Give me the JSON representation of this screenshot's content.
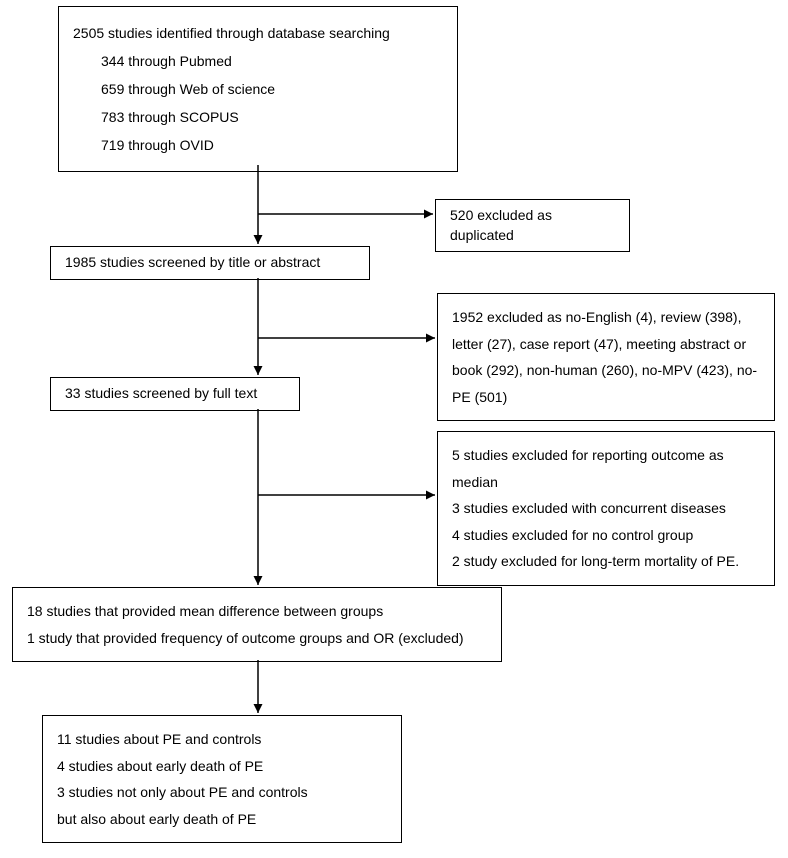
{
  "chart_data": {
    "type": "flow",
    "nodes": [
      {
        "id": "identified",
        "lines": [
          "2505 studies identified through database searching",
          "344 through Pubmed",
          "659 through Web of science",
          "783 through SCOPUS",
          "719 through OVID"
        ]
      },
      {
        "id": "dup",
        "lines": [
          "520 excluded as duplicated"
        ]
      },
      {
        "id": "screened_title",
        "lines": [
          "1985 studies screened by title or abstract"
        ]
      },
      {
        "id": "excl1952",
        "lines": [
          "1952 excluded as no-English (4), review (398), letter (27), case report (47), meeting abstract or book (292), non-human (260), no-MPV (423), no-PE (501)"
        ]
      },
      {
        "id": "screened_full",
        "lines": [
          "33 studies screened by full text"
        ]
      },
      {
        "id": "excl_full",
        "lines": [
          "5 studies excluded for reporting outcome as median",
          "3 studies excluded with concurrent diseases",
          "4 studies excluded for no control group",
          "2 study excluded for long-term mortality of PE."
        ]
      },
      {
        "id": "provided",
        "lines": [
          "18 studies that provided mean difference between groups",
          "1 study that provided frequency of outcome groups and OR (excluded)"
        ]
      },
      {
        "id": "final",
        "lines": [
          "11 studies about PE and controls",
          "4 studies about early death of PE",
          "3 studies not only about PE and controls",
          "but also about early death of PE"
        ]
      }
    ],
    "edges": [
      [
        "identified",
        "screened_title"
      ],
      [
        "identified",
        "dup"
      ],
      [
        "screened_title",
        "screened_full"
      ],
      [
        "screened_title",
        "excl1952"
      ],
      [
        "screened_full",
        "provided"
      ],
      [
        "screened_full",
        "excl_full"
      ],
      [
        "provided",
        "final"
      ]
    ]
  },
  "boxes": {
    "identified": {
      "header": "2505 studies identified through database searching",
      "items": [
        "344 through Pubmed",
        "659 through Web of science",
        "783 through SCOPUS",
        "719 through OVID"
      ]
    },
    "dup": "520 excluded as duplicated",
    "screened_title": "1985 studies screened by title or abstract",
    "excl1952": "1952 excluded as no-English (4), review (398), letter (27), case report (47), meeting abstract or book (292), non-human (260), no-MPV (423), no-PE (501)",
    "screened_full": "33 studies screened by full text",
    "excl_full": {
      "l1": "5 studies excluded for reporting outcome as median",
      "l2": "3 studies excluded with concurrent diseases",
      "l3": "4 studies excluded for no control group",
      "l4": "2 study excluded for long-term mortality of PE."
    },
    "provided": {
      "l1": "18 studies that provided mean difference between groups",
      "l2": "1 study that provided frequency of outcome groups and OR (excluded)"
    },
    "final": {
      "l1": "11 studies about PE and controls",
      "l2": "4 studies about early death of PE",
      "l3": "3 studies not only about PE and controls",
      "l4": "but also about early death of PE"
    }
  }
}
